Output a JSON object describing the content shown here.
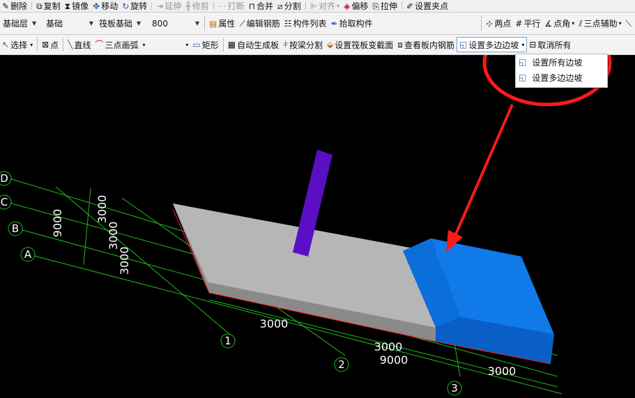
{
  "toolbar1": {
    "delete": "删除",
    "copy": "复制",
    "mirror": "镜像",
    "move": "移动",
    "rotate": "旋转",
    "extend": "延伸",
    "trim": "修剪",
    "break": "打断",
    "merge": "合并",
    "split": "分割",
    "align": "对齐",
    "offset": "偏移",
    "stretch": "拉伸",
    "set_grip": "设置夹点"
  },
  "toolbar2": {
    "layer_value": "基础层",
    "category_value": "基础",
    "component_value": "筏板基础",
    "size_value": "800",
    "properties": "属性",
    "edit_rebar": "编辑钢筋",
    "component_list": "构件列表",
    "pick_component": "拾取构件",
    "two_points": "两点",
    "parallel": "平行",
    "point_angle": "点角",
    "three_point_aux": "三点辅助"
  },
  "toolbar3": {
    "select": "选择",
    "point": "点",
    "line": "直线",
    "arc": "三点画弧",
    "rectangle": "矩形",
    "auto_slab": "自动生成板",
    "split_by_beam": "按梁分割",
    "set_variable_section": "设置筏板变截面",
    "view_slab_rebar": "查看板内钢筋",
    "set_multi_slope": "设置多边边坡",
    "cancel_all": "取消所有"
  },
  "dropdown": {
    "items": [
      "设置所有边坡",
      "设置多边边坡"
    ]
  },
  "scene": {
    "axis_letters": [
      "D",
      "C",
      "B",
      "A"
    ],
    "axis_numbers": [
      "1",
      "2",
      "3"
    ],
    "left_dims": [
      "9000",
      "3000",
      "3000",
      "3000"
    ],
    "bottom_dims": [
      "3000",
      "3000",
      "9000",
      "3000"
    ]
  },
  "colors": {
    "grid": "#1fbf1f",
    "slab_top": "#b6b6b6",
    "slab_side": "#8c8c8c",
    "slope_blue": "#0f7ae8",
    "column": "#5b0fc4",
    "annotation": "#ff1a1a"
  }
}
